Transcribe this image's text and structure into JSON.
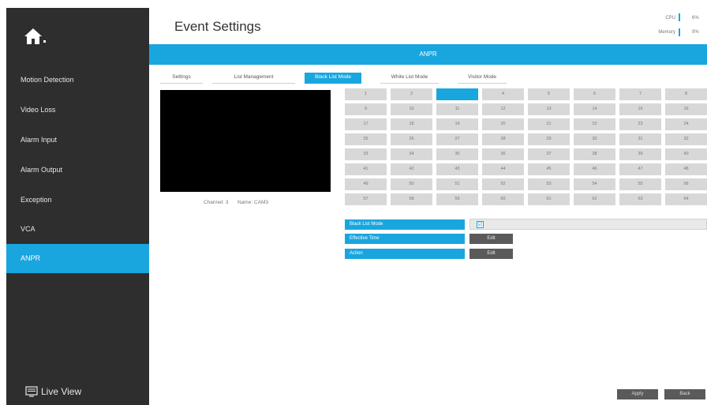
{
  "sidebar": {
    "home_icon": "home-icon",
    "items": [
      {
        "label": "Motion Detection"
      },
      {
        "label": "Video Loss"
      },
      {
        "label": "Alarm Input"
      },
      {
        "label": "Alarm Output"
      },
      {
        "label": "Exception"
      },
      {
        "label": "VCA"
      },
      {
        "label": "ANPR",
        "active": true
      }
    ],
    "live_view": {
      "label": "Live View",
      "icon": "monitor-icon"
    }
  },
  "header": {
    "title": "Event Settings",
    "cpu": {
      "label": "CPU",
      "value": "6%"
    },
    "memory": {
      "label": "Memory",
      "value": "9%"
    }
  },
  "banner": {
    "title": "ANPR"
  },
  "tabs": [
    {
      "label": "Settings"
    },
    {
      "label": "List Management"
    },
    {
      "label": "Black List Mode",
      "active": true
    },
    {
      "label": "White List Mode"
    },
    {
      "label": "Visitor Mode"
    }
  ],
  "video": {
    "channel_label": "Channel: 3",
    "name_label": "Name: CAM3"
  },
  "channels": {
    "selected": 3,
    "labels": [
      "1",
      "2",
      "3",
      "4",
      "5",
      "6",
      "7",
      "8",
      "9",
      "10",
      "11",
      "12",
      "13",
      "14",
      "15",
      "16",
      "17",
      "18",
      "19",
      "20",
      "21",
      "22",
      "23",
      "24",
      "25",
      "26",
      "27",
      "28",
      "29",
      "30",
      "31",
      "32",
      "33",
      "34",
      "35",
      "36",
      "37",
      "38",
      "39",
      "40",
      "41",
      "42",
      "43",
      "44",
      "45",
      "46",
      "47",
      "48",
      "49",
      "50",
      "51",
      "52",
      "53",
      "54",
      "55",
      "56",
      "57",
      "58",
      "59",
      "60",
      "61",
      "62",
      "63",
      "64"
    ]
  },
  "settings": {
    "black_list_mode": {
      "label": "Black List Mode",
      "checked": true,
      "check_glyph": "☑"
    },
    "effective_time": {
      "label": "Effective Time",
      "button": "Edit"
    },
    "action": {
      "label": "Action",
      "button": "Edit"
    }
  },
  "footer": {
    "apply": "Apply",
    "back": "Back"
  },
  "colors": {
    "accent": "#19a6de",
    "sidebar": "#2e2e2e",
    "button": "#5a5a5a"
  }
}
